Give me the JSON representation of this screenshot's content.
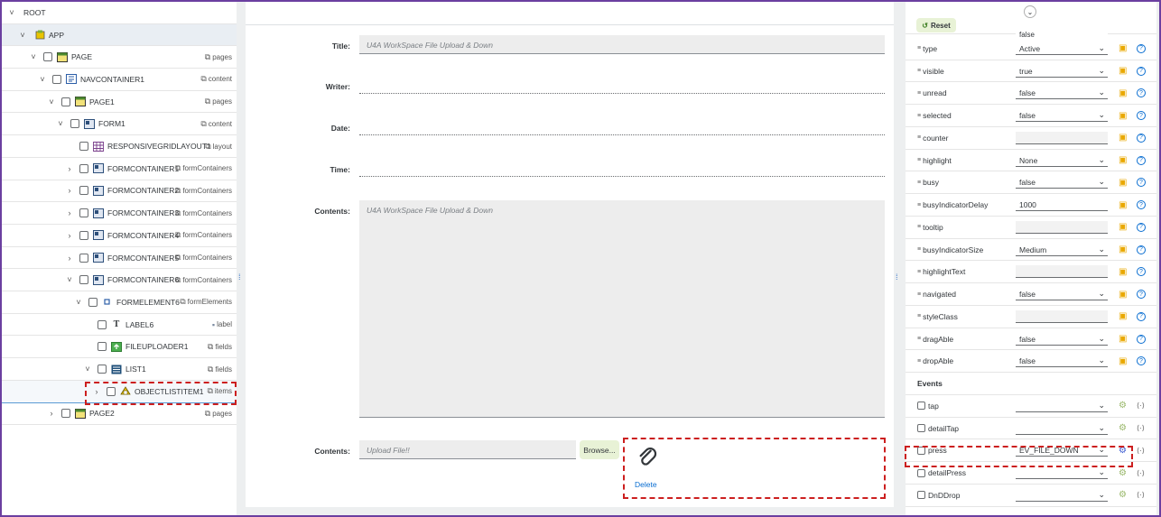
{
  "tree": {
    "rows": [
      {
        "label": "ROOT",
        "agg": "",
        "expand": "˅"
      },
      {
        "label": "APP",
        "agg": "",
        "expand": "˅"
      },
      {
        "label": "PAGE",
        "agg": "pages",
        "expand": "˅"
      },
      {
        "label": "NAVCONTAINER1",
        "agg": "content",
        "expand": "˅"
      },
      {
        "label": "PAGE1",
        "agg": "pages",
        "expand": "˅"
      },
      {
        "label": "FORM1",
        "agg": "content",
        "expand": "˅"
      },
      {
        "label": "RESPONSIVEGRIDLAYOUT1",
        "agg": "layout",
        "expand": ""
      },
      {
        "label": "FORMCONTAINER1",
        "agg": "formContainers",
        "expand": "›"
      },
      {
        "label": "FORMCONTAINER2",
        "agg": "formContainers",
        "expand": "›"
      },
      {
        "label": "FORMCONTAINER3",
        "agg": "formContainers",
        "expand": "›"
      },
      {
        "label": "FORMCONTAINER4",
        "agg": "formContainers",
        "expand": "›"
      },
      {
        "label": "FORMCONTAINER5",
        "agg": "formContainers",
        "expand": "›"
      },
      {
        "label": "FORMCONTAINER6",
        "agg": "formContainers",
        "expand": "˅"
      },
      {
        "label": "FORMELEMENT6",
        "agg": "formElements",
        "expand": "˅"
      },
      {
        "label": "LABEL6",
        "agg": "label",
        "expand": ""
      },
      {
        "label": "FILEUPLOADER1",
        "agg": "fields",
        "expand": ""
      },
      {
        "label": "LIST1",
        "agg": "fields",
        "expand": "˅"
      },
      {
        "label": "OBJECTLISTITEM1",
        "agg": "items",
        "expand": "›"
      },
      {
        "label": "PAGE2",
        "agg": "pages",
        "expand": "›"
      }
    ]
  },
  "form": {
    "title_label": "Title:",
    "title_value": "U4A WorkSpace File Upload & Down",
    "writer_label": "Writer:",
    "date_label": "Date:",
    "time_label": "Time:",
    "contents_label": "Contents:",
    "contents_value": "U4A WorkSpace File Upload & Down",
    "upload_label": "Contents:",
    "upload_placeholder": "Upload File!!",
    "browse_label": "Browse...",
    "delete_label": "Delete"
  },
  "props": {
    "reset_label": "Reset",
    "rows": [
      {
        "name": "type",
        "value": "Active",
        "dropdown": true
      },
      {
        "name": "visible",
        "value": "true",
        "dropdown": true
      },
      {
        "name": "unread",
        "value": "false",
        "dropdown": true
      },
      {
        "name": "selected",
        "value": "false",
        "dropdown": true
      },
      {
        "name": "counter",
        "value": "",
        "dropdown": false
      },
      {
        "name": "highlight",
        "value": "None",
        "dropdown": true
      },
      {
        "name": "busy",
        "value": "false",
        "dropdown": true
      },
      {
        "name": "busyIndicatorDelay",
        "value": "1000",
        "dropdown": false
      },
      {
        "name": "tooltip",
        "value": "",
        "dropdown": false
      },
      {
        "name": "busyIndicatorSize",
        "value": "Medium",
        "dropdown": true
      },
      {
        "name": "highlightText",
        "value": "",
        "dropdown": false
      },
      {
        "name": "navigated",
        "value": "false",
        "dropdown": true
      },
      {
        "name": "styleClass",
        "value": "",
        "dropdown": false
      },
      {
        "name": "dragAble",
        "value": "false",
        "dropdown": true
      },
      {
        "name": "dropAble",
        "value": "false",
        "dropdown": true
      }
    ],
    "partial_top_value": "false",
    "events_label": "Events",
    "events": [
      {
        "name": "tap",
        "value": ""
      },
      {
        "name": "detailTap",
        "value": ""
      },
      {
        "name": "press",
        "value": "EV_FILE_DOWN"
      },
      {
        "name": "detailPress",
        "value": ""
      },
      {
        "name": "DnDDrop",
        "value": ""
      }
    ]
  },
  "colors": {
    "accent_border": "#6b3fa0",
    "highlight_dash": "#cc1f1f",
    "link": "#0a6ed1",
    "button_bg": "#e8f2d6"
  }
}
